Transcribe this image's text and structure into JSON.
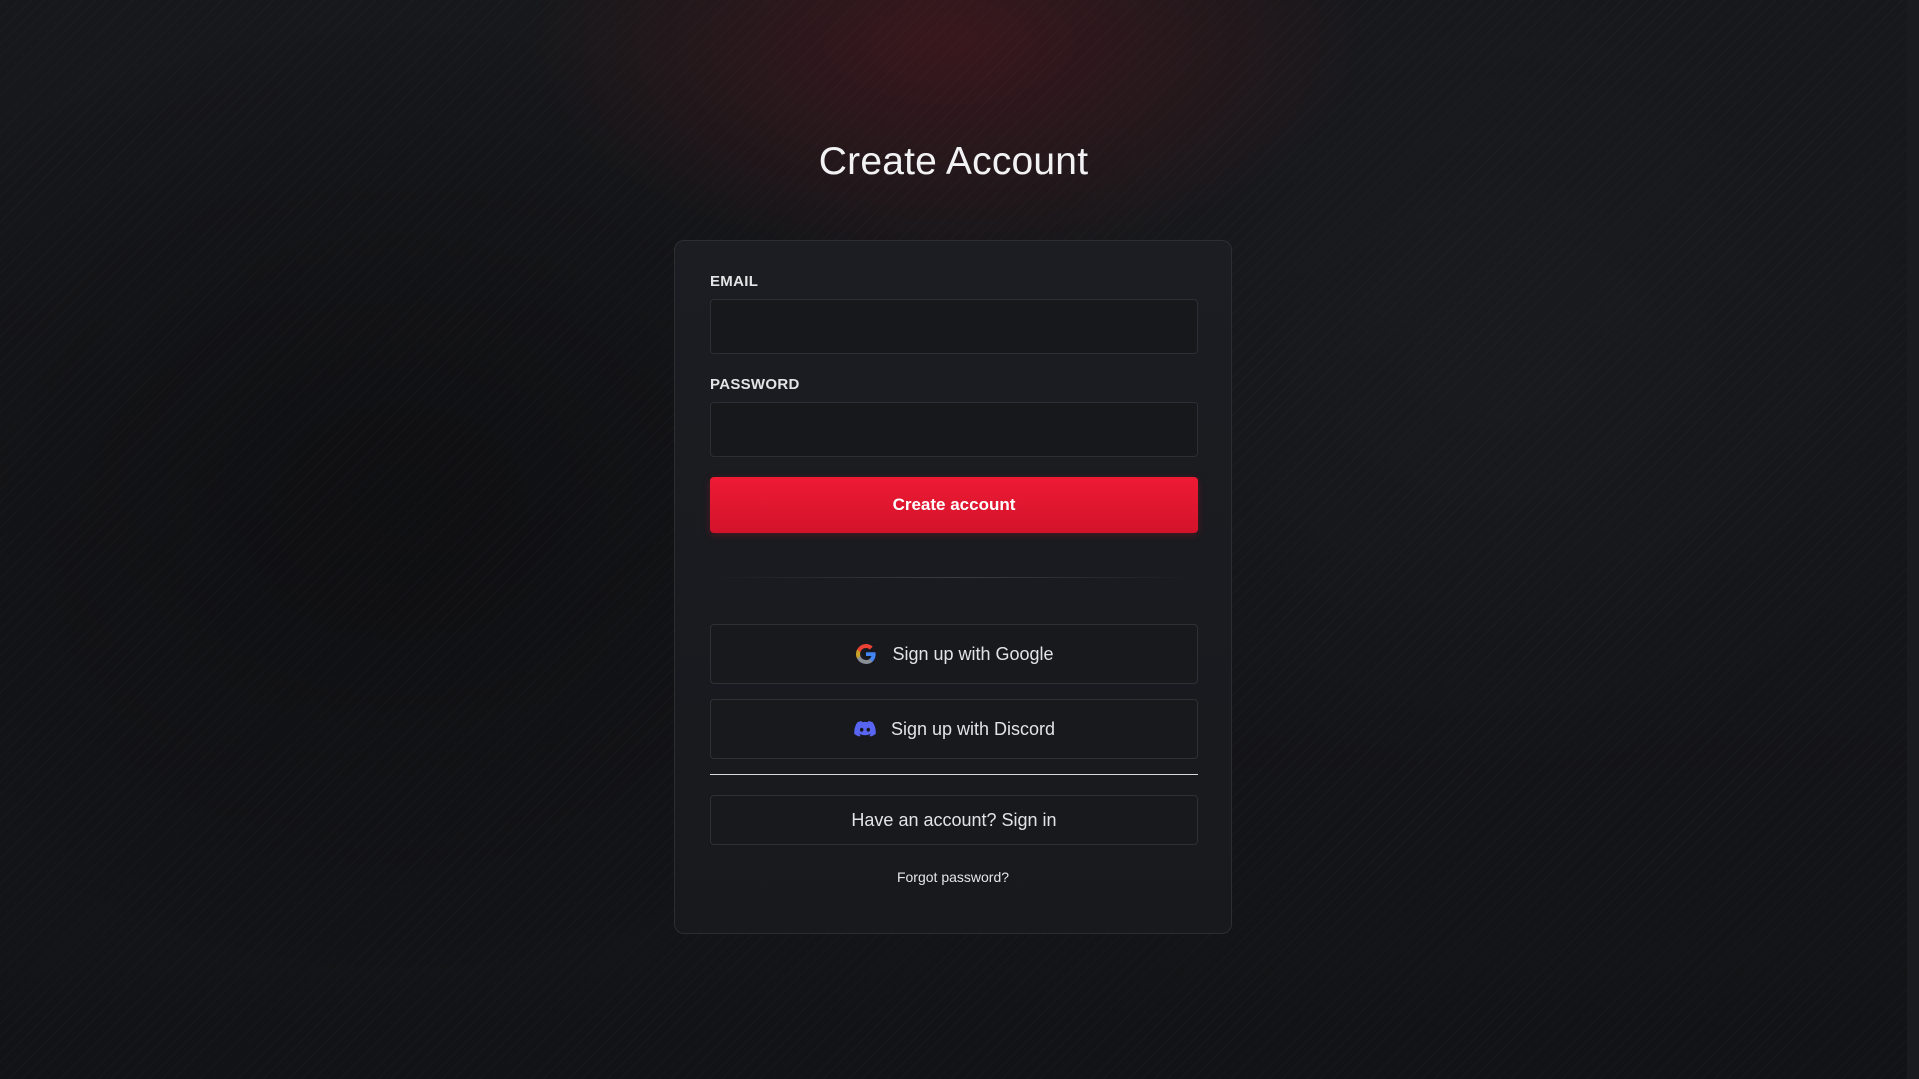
{
  "page": {
    "title": "Create Account"
  },
  "form": {
    "email_label": "EMAIL",
    "email_value": "",
    "password_label": "PASSWORD",
    "password_value": "",
    "submit_label": "Create account"
  },
  "oauth": {
    "google_label": "Sign up with Google",
    "google_icon": "google-icon",
    "discord_label": "Sign up with Discord",
    "discord_icon": "discord-icon"
  },
  "footer": {
    "signin_label": "Have an account? Sign in",
    "forgot_label": "Forgot password?"
  },
  "colors": {
    "accent": "#e8182f",
    "background": "#131417",
    "card": "#1a1c20",
    "discord": "#5865f2"
  }
}
